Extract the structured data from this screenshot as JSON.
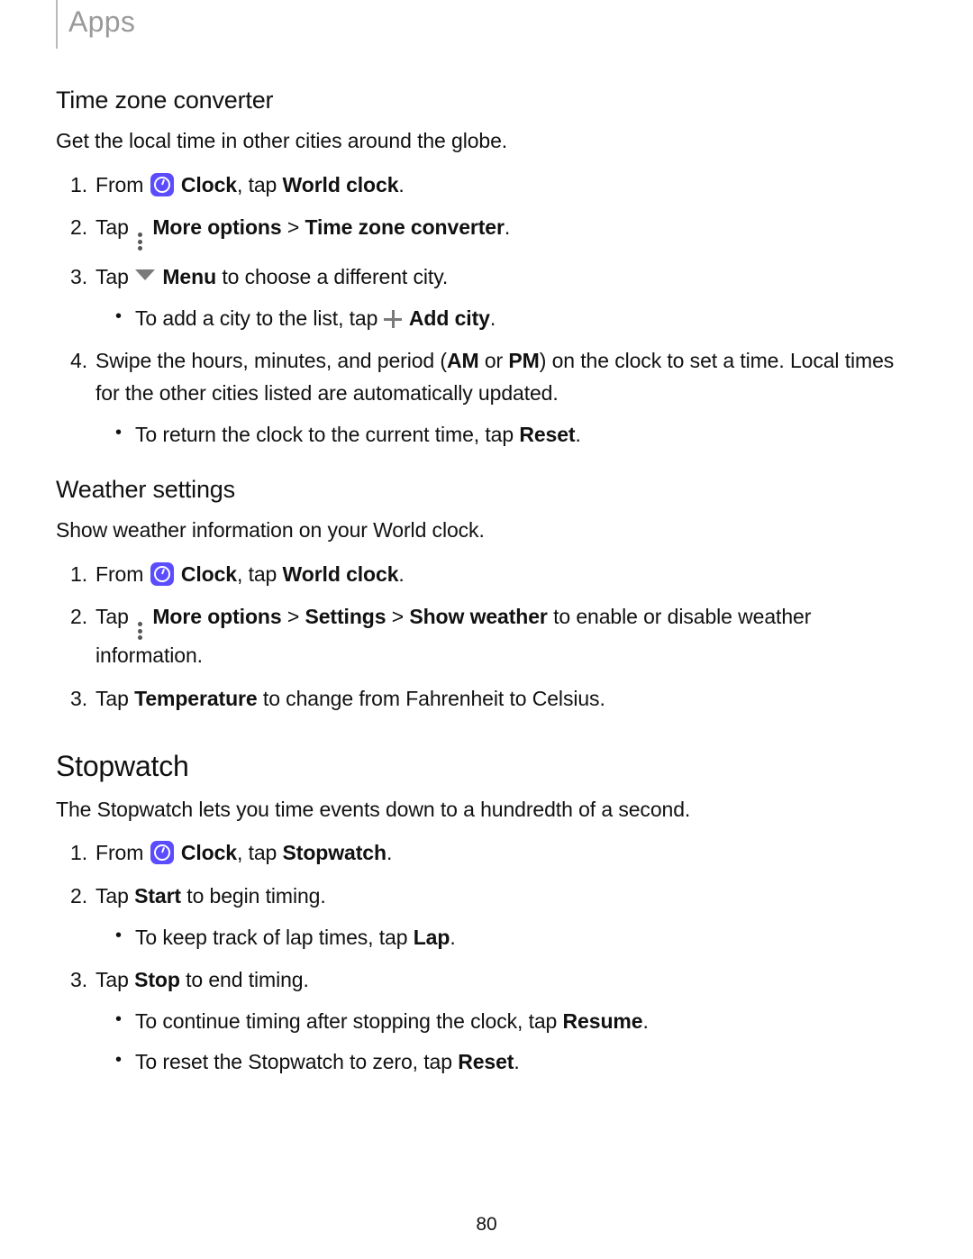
{
  "header": {
    "title": "Apps"
  },
  "sections": {
    "tz": {
      "heading": "Time zone converter",
      "intro": "Get the local time in other cities around the globe.",
      "s1_a": "From ",
      "s1_b": "Clock",
      "s1_c": ", tap ",
      "s1_d": "World clock",
      "s1_e": ".",
      "s2_a": "Tap ",
      "s2_b": "More options",
      "s2_c": " > ",
      "s2_d": "Time zone converter",
      "s2_e": ".",
      "s3_a": "Tap ",
      "s3_b": "Menu",
      "s3_c": " to choose a different city.",
      "s3_sub_a": "To add a city to the list, tap ",
      "s3_sub_b": "Add city",
      "s3_sub_c": ".",
      "s4_a": "Swipe the hours, minutes, and period (",
      "s4_b": "AM",
      "s4_c": " or ",
      "s4_d": "PM",
      "s4_e": ") on the clock to set a time. Local times for the other cities listed are automatically updated.",
      "s4_sub_a": "To return the clock to the current time, tap ",
      "s4_sub_b": "Reset",
      "s4_sub_c": "."
    },
    "weather": {
      "heading": "Weather settings",
      "intro": "Show weather information on your World clock.",
      "s1_a": "From ",
      "s1_b": "Clock",
      "s1_c": ", tap ",
      "s1_d": "World clock",
      "s1_e": ".",
      "s2_a": "Tap ",
      "s2_b": "More options",
      "s2_c": " > ",
      "s2_d": "Settings",
      "s2_e": " > ",
      "s2_f": "Show weather",
      "s2_g": " to enable or disable weather information.",
      "s3_a": "Tap ",
      "s3_b": "Temperature",
      "s3_c": " to change from Fahrenheit to Celsius."
    },
    "stopwatch": {
      "heading": "Stopwatch",
      "intro": "The Stopwatch lets you time events down to a hundredth of a second.",
      "s1_a": "From ",
      "s1_b": "Clock",
      "s1_c": ", tap ",
      "s1_d": "Stopwatch",
      "s1_e": ".",
      "s2_a": "Tap ",
      "s2_b": "Start",
      "s2_c": " to begin timing.",
      "s2_sub_a": "To keep track of lap times, tap ",
      "s2_sub_b": "Lap",
      "s2_sub_c": ".",
      "s3_a": "Tap ",
      "s3_b": "Stop",
      "s3_c": " to end timing.",
      "s3_sub1_a": "To continue timing after stopping the clock, tap ",
      "s3_sub1_b": "Resume",
      "s3_sub1_c": ".",
      "s3_sub2_a": "To reset the Stopwatch to zero, tap ",
      "s3_sub2_b": "Reset",
      "s3_sub2_c": "."
    }
  },
  "page_number": "80"
}
